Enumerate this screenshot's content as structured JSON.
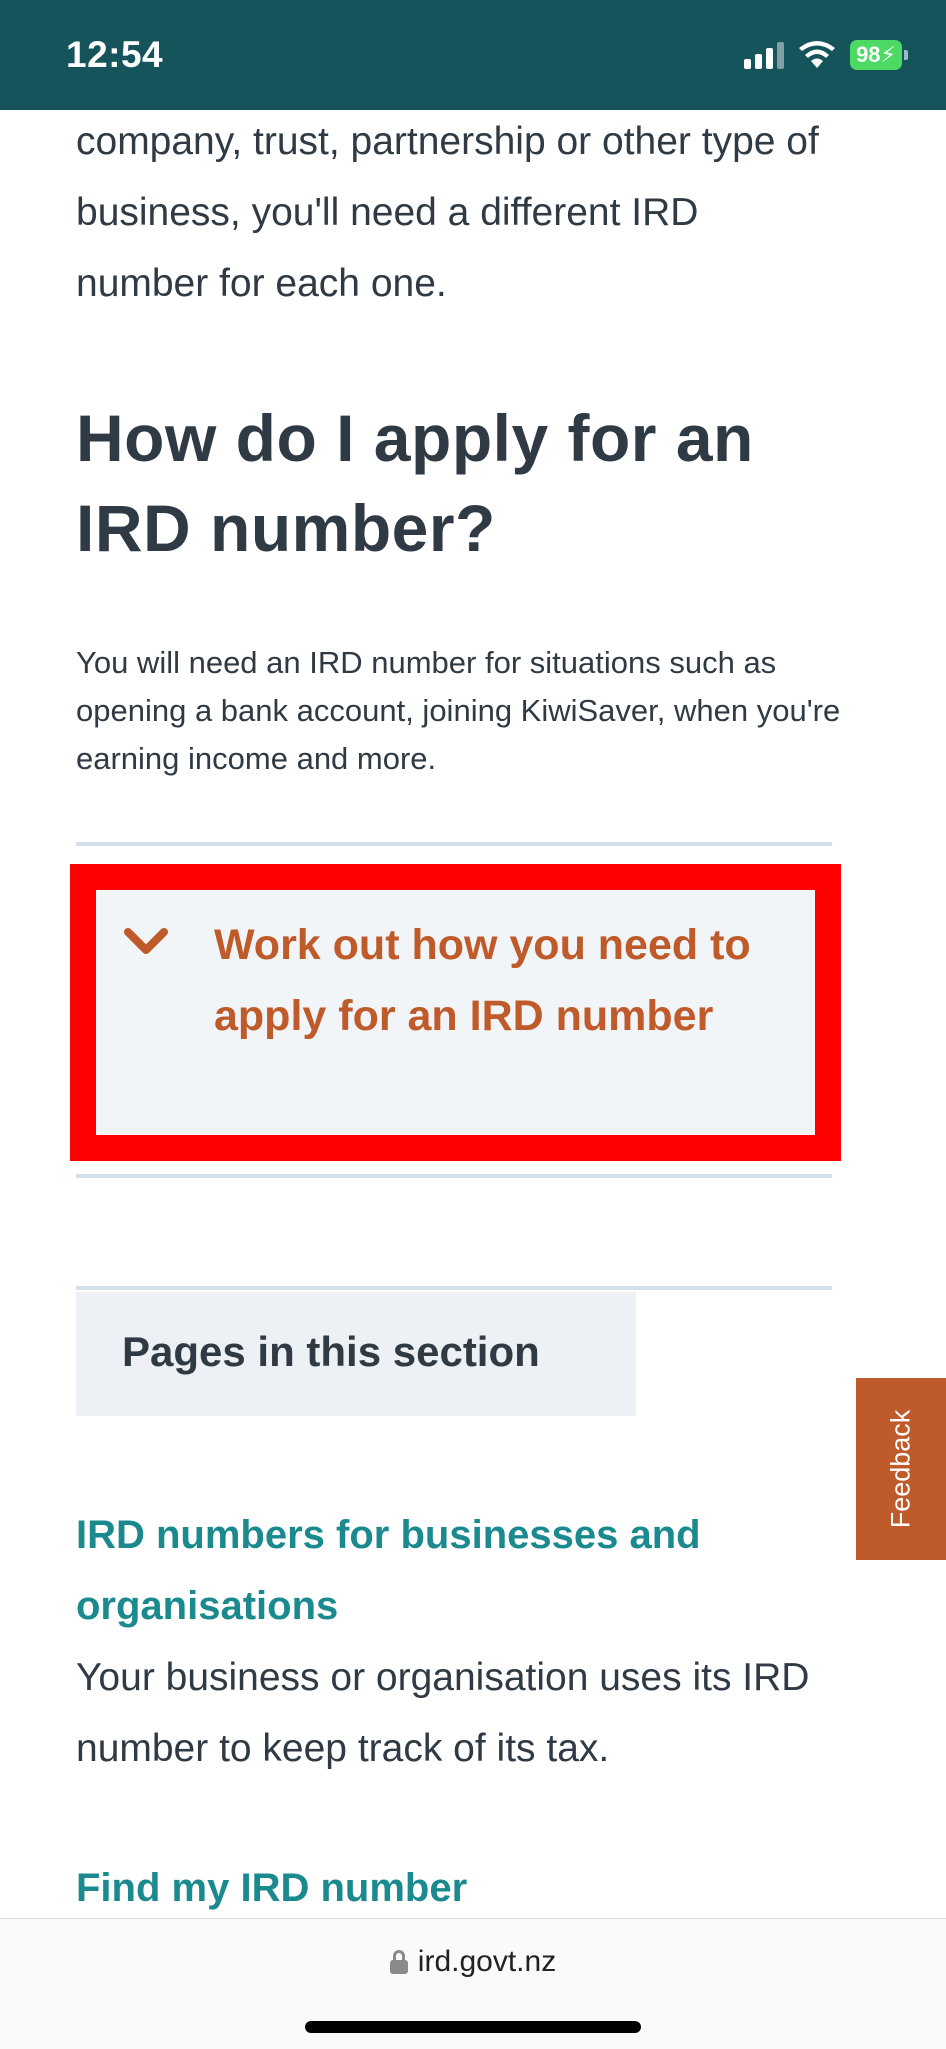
{
  "status_bar": {
    "time": "12:54",
    "battery": "98"
  },
  "content": {
    "intro_text": "company, trust, partnership or other type of business, you'll need a different IRD number for each one.",
    "heading": "How do I apply for an IRD number?",
    "lead": "You will need an IRD number for situations such as opening a bank account, joining KiwiSaver, when you're earning income and more."
  },
  "accordion": {
    "title": "Work out how you need to apply for an IRD number",
    "icon": "chevron-down-icon",
    "highlight_color": "#ff0000",
    "accent_color": "#bf5a2a"
  },
  "section": {
    "title": "Pages in this section",
    "links": [
      {
        "label": "IRD numbers for businesses and organisations",
        "description": "Your business or organisation uses its IRD number to keep track of its tax."
      },
      {
        "label": "Find my IRD number",
        "description": ""
      }
    ]
  },
  "feedback": {
    "label": "Feedback"
  },
  "browser": {
    "url": "ird.govt.nz"
  },
  "colors": {
    "header_bg": "#16545c",
    "link": "#1a8a8f",
    "text": "#2f3a44"
  }
}
